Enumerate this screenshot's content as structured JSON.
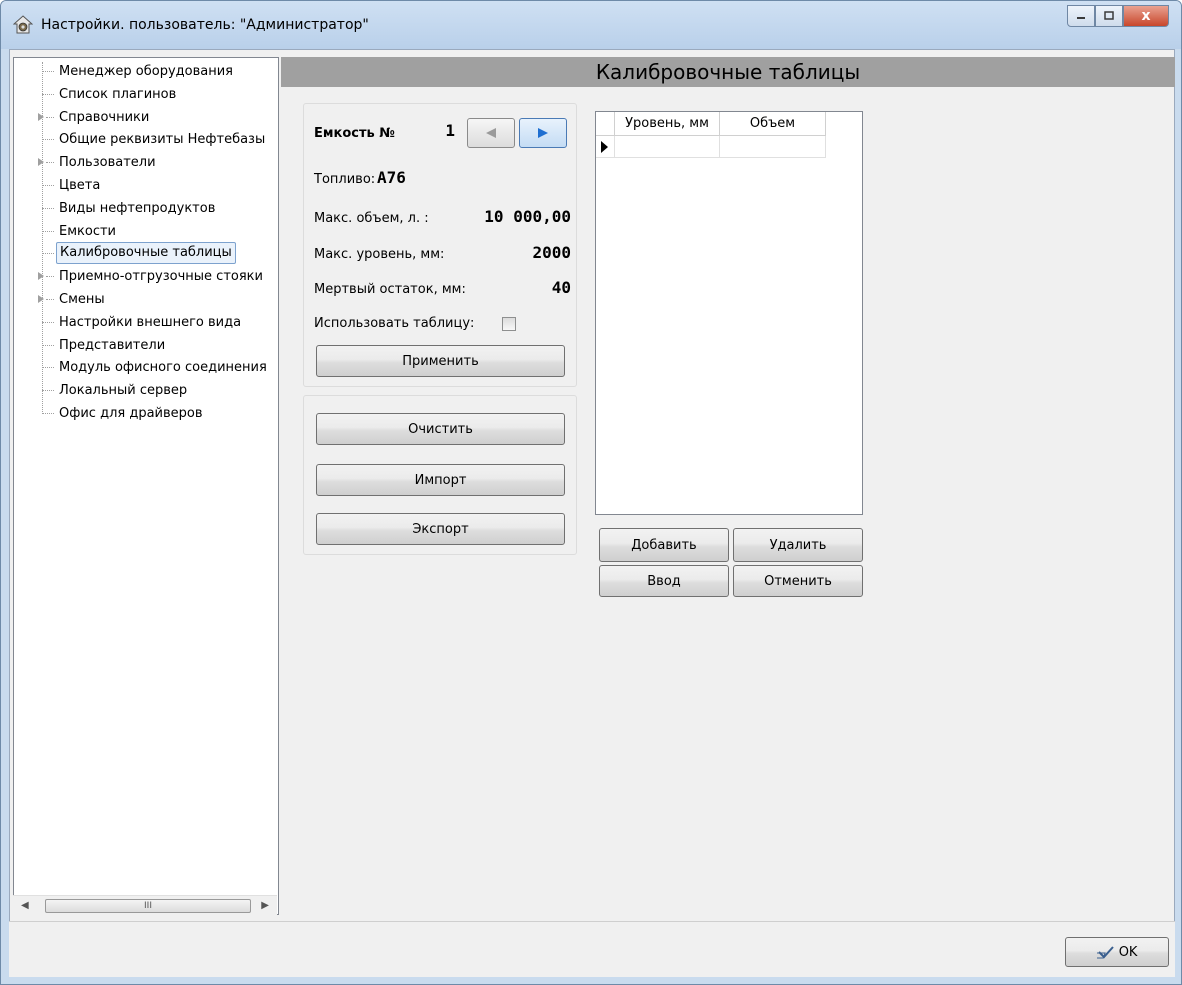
{
  "window": {
    "title": "Настройки. пользователь: \"Администратор\"",
    "close_glyph": "x"
  },
  "tree": {
    "items": [
      {
        "label": "Менеджер оборудования",
        "expandable": false,
        "selected": false
      },
      {
        "label": "Список плагинов",
        "expandable": false,
        "selected": false
      },
      {
        "label": "Справочники",
        "expandable": true,
        "selected": false
      },
      {
        "label": "Общие реквизиты Нефтебазы",
        "expandable": false,
        "selected": false
      },
      {
        "label": "Пользователи",
        "expandable": true,
        "selected": false
      },
      {
        "label": "Цвета",
        "expandable": false,
        "selected": false
      },
      {
        "label": "Виды нефтепродуктов",
        "expandable": false,
        "selected": false
      },
      {
        "label": "Емкости",
        "expandable": false,
        "selected": false
      },
      {
        "label": "Калибровочные таблицы",
        "expandable": false,
        "selected": true
      },
      {
        "label": "Приемно-отгрузочные стояки",
        "expandable": true,
        "selected": false
      },
      {
        "label": "Смены",
        "expandable": true,
        "selected": false
      },
      {
        "label": "Настройки внешнего вида",
        "expandable": false,
        "selected": false
      },
      {
        "label": "Представители",
        "expandable": false,
        "selected": false
      },
      {
        "label": "Модуль офисного соединения",
        "expandable": false,
        "selected": false
      },
      {
        "label": "Локальный сервер",
        "expandable": false,
        "selected": false
      },
      {
        "label": "Офис для драйверов",
        "expandable": false,
        "selected": false
      }
    ],
    "scroll_thumb_glyph": "III"
  },
  "panel": {
    "title": "Калибровочные таблицы"
  },
  "tank": {
    "number_label": "Емкость №",
    "number_value": "1",
    "fuel_label": "Топливо:",
    "fuel_value": "А76",
    "max_volume_label": "Макс. объем, л. :",
    "max_volume_value": "10 000,00",
    "max_level_label": "Макс. уровень, мм:",
    "max_level_value": "2000",
    "dead_rest_label": "Мертвый остаток, мм:",
    "dead_rest_value": "40",
    "use_table_label": "Использовать таблицу:",
    "use_table_checked": false,
    "apply_label": "Применить"
  },
  "actions": {
    "clear_label": "Очистить",
    "import_label": "Импорт",
    "export_label": "Экспорт"
  },
  "grid": {
    "columns": [
      "Уровень, мм",
      "Объем"
    ]
  },
  "grid_actions": {
    "add_label": "Добавить",
    "delete_label": "Удалить",
    "enter_label": "Ввод",
    "cancel_label": "Отменить"
  },
  "footer": {
    "ok_label": "OK"
  },
  "colors": {
    "titlebar": "#c9dbee",
    "panel_header": "#a0a0a0",
    "selection_border": "#7da2ce",
    "nav_arrow": "#1f6fd1",
    "close_button": "#c8462b"
  }
}
